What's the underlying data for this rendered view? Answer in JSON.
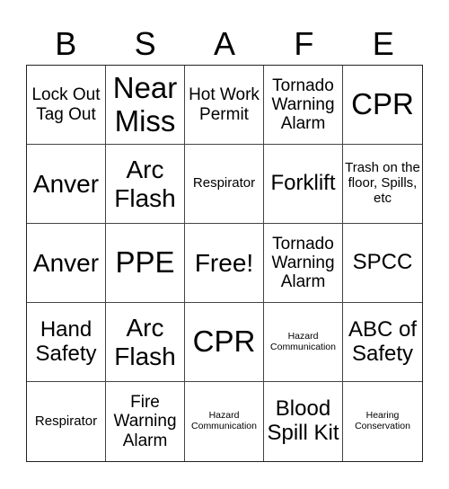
{
  "header": {
    "letters": [
      "B",
      "S",
      "A",
      "F",
      "E"
    ]
  },
  "board": {
    "rows": [
      [
        {
          "text": "Lock Out Tag Out",
          "size": "sm"
        },
        {
          "text": "Near Miss",
          "size": "xl"
        },
        {
          "text": "Hot Work Permit",
          "size": "sm"
        },
        {
          "text": "Tornado Warning Alarm",
          "size": "sm"
        },
        {
          "text": "CPR",
          "size": "xl"
        }
      ],
      [
        {
          "text": "Anver",
          "size": "lg"
        },
        {
          "text": "Arc Flash",
          "size": "lg"
        },
        {
          "text": "Respirator",
          "size": "xs"
        },
        {
          "text": "Forklift",
          "size": "md"
        },
        {
          "text": "Trash on the floor, Spills, etc",
          "size": "xs"
        }
      ],
      [
        {
          "text": "Anver",
          "size": "lg"
        },
        {
          "text": "PPE",
          "size": "xl"
        },
        {
          "text": "Free!",
          "size": "lg"
        },
        {
          "text": "Tornado Warning Alarm",
          "size": "sm"
        },
        {
          "text": "SPCC",
          "size": "md"
        }
      ],
      [
        {
          "text": "Hand Safety",
          "size": "md"
        },
        {
          "text": "Arc Flash",
          "size": "lg"
        },
        {
          "text": "CPR",
          "size": "xl"
        },
        {
          "text": "Hazard Communication",
          "size": "xxs"
        },
        {
          "text": "ABC of Safety",
          "size": "md"
        }
      ],
      [
        {
          "text": "Respirator",
          "size": "xs"
        },
        {
          "text": "Fire Warning Alarm",
          "size": "sm"
        },
        {
          "text": "Hazard Communication",
          "size": "xxs"
        },
        {
          "text": "Blood Spill Kit",
          "size": "md"
        },
        {
          "text": "Hearing Conservation",
          "size": "xxs"
        }
      ]
    ]
  }
}
